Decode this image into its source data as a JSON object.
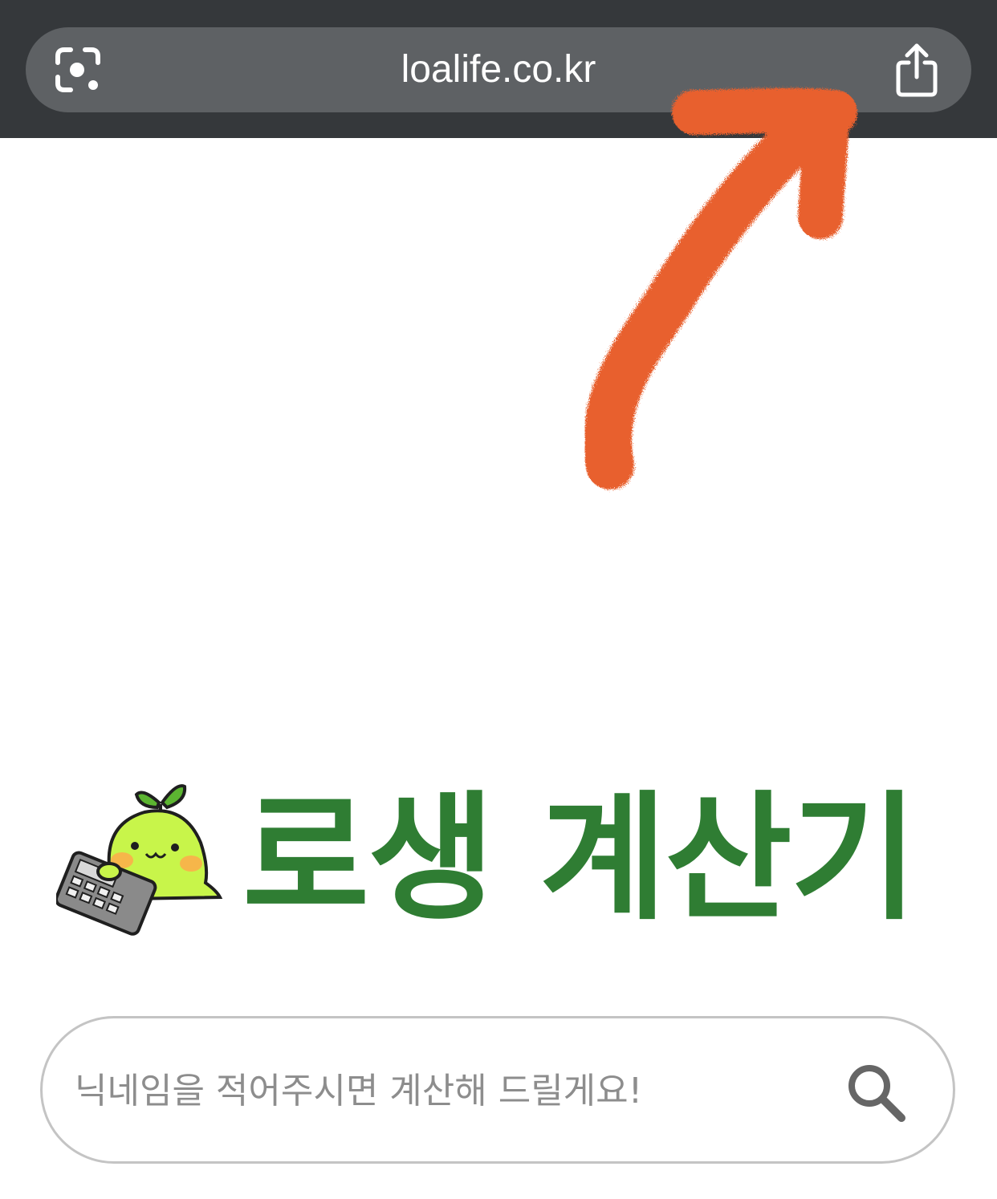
{
  "browser": {
    "url": "loalife.co.kr",
    "icons": {
      "left": "visual-search-icon",
      "right": "share-icon"
    }
  },
  "annotation": {
    "type": "hand-drawn-arrow",
    "color": "#e8612e"
  },
  "header": {
    "title": "로생 계산기",
    "title_color": "#2f7d33",
    "mascot": "sprout-calculator-mascot"
  },
  "search": {
    "placeholder": "닉네임을 적어주시면 계산해 드릴게요!",
    "value": "",
    "icon": "search-icon"
  },
  "colors": {
    "topbar_bg": "#35383b",
    "url_pill_bg": "#5e6164",
    "search_border": "#c4c4c4"
  }
}
